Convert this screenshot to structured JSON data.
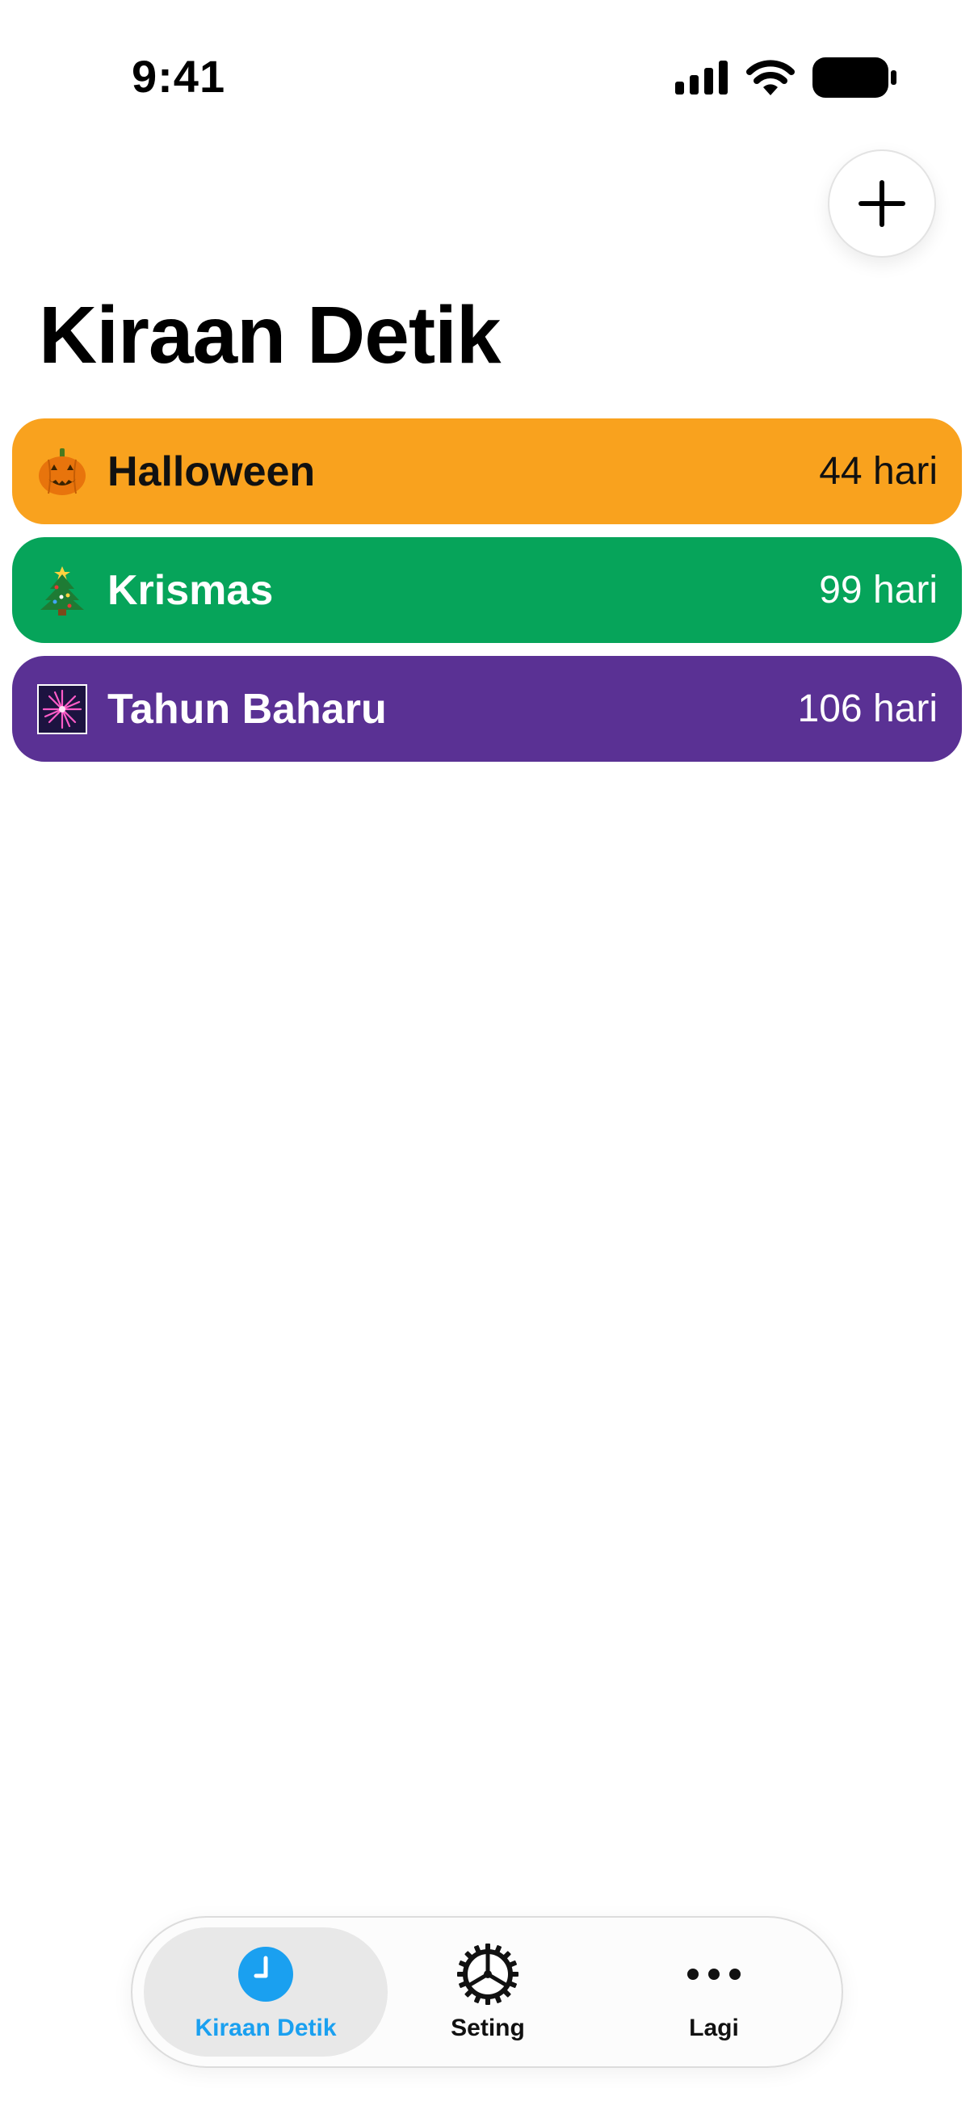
{
  "status_bar": {
    "time": "9:41"
  },
  "header": {
    "title": "Kiraan Detik"
  },
  "events": [
    {
      "name": "Halloween",
      "days": "44 hari",
      "color": "#F9A21E",
      "text_color": "#111111",
      "icon": "pumpkin-icon"
    },
    {
      "name": "Krismas",
      "days": "99 hari",
      "color": "#06A45A",
      "text_color": "#ffffff",
      "icon": "christmas-tree-icon"
    },
    {
      "name": "Tahun Baharu",
      "days": "106 hari",
      "color": "#5A3194",
      "text_color": "#ffffff",
      "icon": "fireworks-icon"
    }
  ],
  "tab_bar": {
    "tabs": [
      {
        "label": "Kiraan Detik",
        "icon": "clock-icon",
        "active": true,
        "color": "#1AA0F0"
      },
      {
        "label": "Seting",
        "icon": "gear-icon",
        "active": false,
        "color": "#111111"
      },
      {
        "label": "Lagi",
        "icon": "more-icon",
        "active": false,
        "color": "#111111"
      }
    ]
  }
}
